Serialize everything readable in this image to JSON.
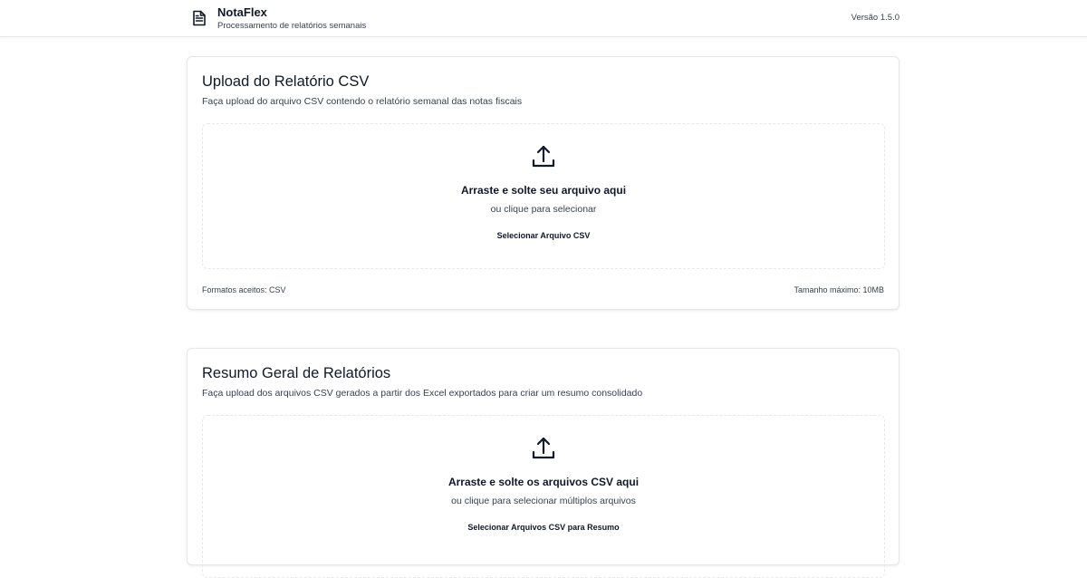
{
  "header": {
    "app_name": "NotaFlex",
    "subtitle": "Processamento de relatórios semanais",
    "version": "Versão 1.5.0",
    "icon": "file-text-icon"
  },
  "upload_card": {
    "title": "Upload do Relatório CSV",
    "description": "Faça upload do arquivo CSV contendo o relatório semanal das notas fiscais",
    "dropzone": {
      "icon": "upload-icon",
      "title": "Arraste e solte seu arquivo aqui",
      "subtitle": "ou clique para selecionar",
      "button_label": "Selecionar Arquivo CSV"
    },
    "accepted_formats": "Formatos aceitos: CSV",
    "max_size": "Tamanho máximo: 10MB"
  },
  "summary_card": {
    "title": "Resumo Geral de Relatórios",
    "description": "Faça upload dos arquivos CSV gerados a partir dos Excel exportados para criar um resumo consolidado",
    "dropzone": {
      "icon": "upload-icon",
      "title": "Arraste e solte os arquivos CSV aqui",
      "subtitle": "ou clique para selecionar múltiplos arquivos",
      "button_label": "Selecionar Arquivos CSV para Resumo"
    }
  },
  "colors": {
    "text_primary": "#111827",
    "text_secondary": "#374151",
    "border": "#e5e7eb",
    "background": "#ffffff"
  }
}
